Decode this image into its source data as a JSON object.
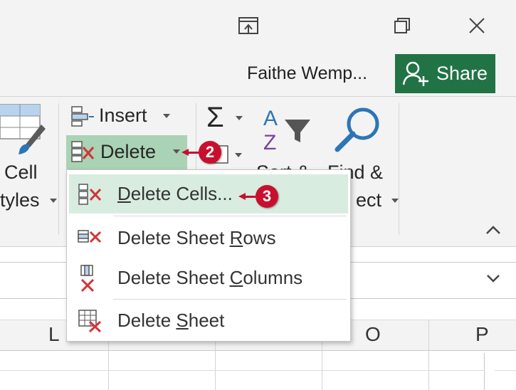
{
  "window": {
    "user_name": "Faithe Wemp...",
    "share_label": "Share",
    "icons": [
      "restore-ribbon-icon",
      "restore-window-icon",
      "close-icon"
    ]
  },
  "ribbon": {
    "cell_styles": {
      "line1": "Cell",
      "line2": "tyles"
    },
    "insert_label": "Insert",
    "delete_label": "Delete",
    "sort_partial": "Sort &",
    "find_line1": "Find &",
    "find_line2": "ect",
    "sum_symbol": "Σ",
    "sort_letters": {
      "a": "A",
      "z": "Z"
    },
    "accent_color": "#217346"
  },
  "delete_menu": {
    "items": [
      {
        "pre": "",
        "key": "D",
        "post": "elete Cells...",
        "icon": "delete-cells-icon",
        "selected": true
      },
      {
        "pre": "Delete Sheet ",
        "key": "R",
        "post": "ows",
        "icon": "delete-rows-icon"
      },
      {
        "pre": "Delete Sheet ",
        "key": "C",
        "post": "olumns",
        "icon": "delete-columns-icon"
      },
      {
        "pre": "Delete ",
        "key": "S",
        "post": "heet",
        "icon": "delete-sheet-icon"
      }
    ]
  },
  "callouts": {
    "step2": "2",
    "step3": "3",
    "color": "#c8102e"
  },
  "grid": {
    "columns": [
      "L",
      "O",
      "P"
    ]
  }
}
